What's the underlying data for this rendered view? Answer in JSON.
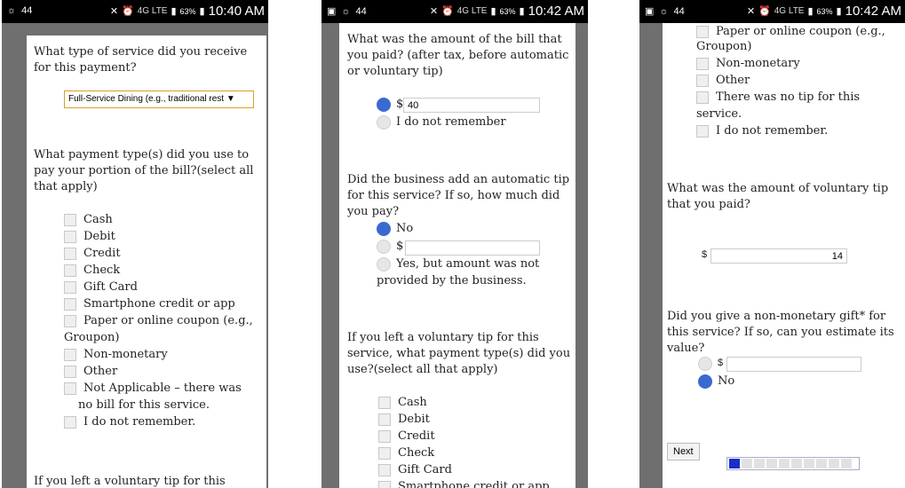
{
  "status": {
    "left": "44",
    "net": "4G LTE",
    "battery": "63%",
    "times": [
      "10:40 AM",
      "10:42 AM",
      "10:42 AM"
    ]
  },
  "panel1": {
    "q_service": "What type of service did you receive for this payment?",
    "service_select": "Full-Service Dining (e.g., traditional rest ▼",
    "q_payment": "What payment type(s) did you use to pay your portion of the bill?(select all that apply)",
    "payment_options": [
      "Cash",
      "Debit",
      "Credit",
      "Check",
      "Gift Card",
      "Smartphone credit or app",
      "Paper or online coupon (e.g.,",
      "Groupon)",
      "Non-monetary",
      "Other",
      "Not Applicable – there was",
      "no bill for this service.",
      "I do not remember."
    ],
    "q_tip_start": "If you left a voluntary tip for this service,"
  },
  "panel2": {
    "q_bill": "What was the amount of the bill that you paid? (after tax, before automatic or voluntary tip)",
    "bill_prefix": "$",
    "bill_value": "40",
    "bill_forgot": "I do not remember",
    "q_autotip": "Did the business add an automatic tip for this service? If so, how much did you pay?",
    "autotip_no": "No",
    "autotip_prefix": "$",
    "autotip_yes_line1": "Yes, but amount was not",
    "autotip_yes_line2": "provided by the business.",
    "q_tiptype": "If you left a voluntary tip for this service, what payment type(s) did you use?(select all that apply)",
    "tip_options": [
      "Cash",
      "Debit",
      "Credit",
      "Check",
      "Gift Card",
      "Smartphone credit or app"
    ]
  },
  "panel3": {
    "top_options": [
      "Paper or online coupon (e.g.,",
      "Groupon)",
      "Non-monetary",
      "Other",
      "There was no tip for this",
      "service.",
      "I do not remember."
    ],
    "q_tipamount": "What was the amount of voluntary tip that you paid?",
    "tip_prefix": "$",
    "tip_value": "14",
    "q_gift": "Did you give a non-monetary gift* for this service? If so, can you estimate its value?",
    "gift_prefix": "$",
    "gift_no": "No",
    "next_label": "Next",
    "progress_completed_segments": 1,
    "progress_total_segments": 10
  }
}
